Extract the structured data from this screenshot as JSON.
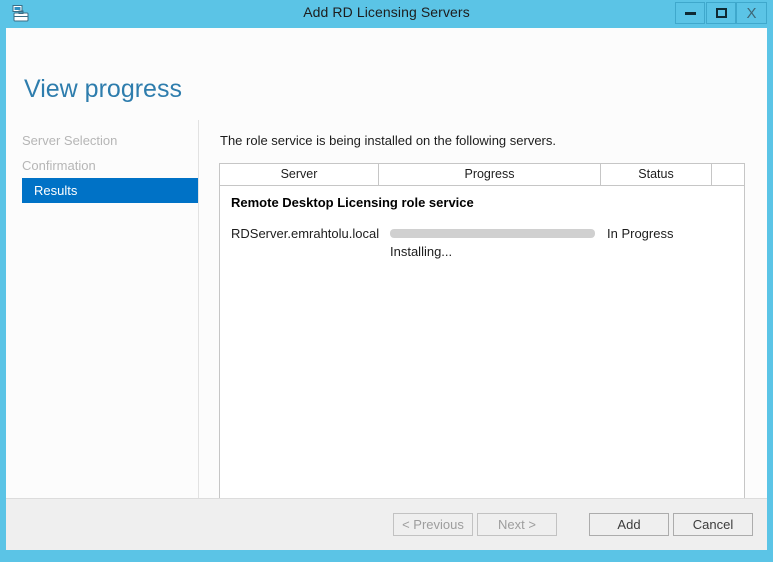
{
  "window": {
    "title": "Add RD Licensing Servers",
    "icon": "server-toolbox-icon",
    "accent_color": "#5BC4E6",
    "controls": {
      "minimize": "—",
      "maximize": "□",
      "close": "X"
    }
  },
  "page": {
    "heading": "View progress",
    "heading_color": "#2E7DAD",
    "intro_text": "The role service is being installed on the following servers."
  },
  "nav": {
    "items": [
      {
        "label": "Server Selection",
        "active": false
      },
      {
        "label": "Confirmation",
        "active": false
      },
      {
        "label": "Results",
        "active": true
      }
    ],
    "active_bg": "#0072C6"
  },
  "table": {
    "columns": [
      "Server",
      "Progress",
      "Status",
      ""
    ],
    "group_label": "Remote Desktop Licensing role service",
    "rows": [
      {
        "server": "RDServer.emrahtolu.local",
        "progress_percent": 0,
        "progress_label": "Installing...",
        "status": "In Progress"
      }
    ]
  },
  "footer": {
    "buttons": [
      {
        "label": "< Previous",
        "enabled": false
      },
      {
        "label": "Next >",
        "enabled": false
      },
      {
        "label": "Add",
        "enabled": true
      },
      {
        "label": "Cancel",
        "enabled": true
      }
    ]
  }
}
